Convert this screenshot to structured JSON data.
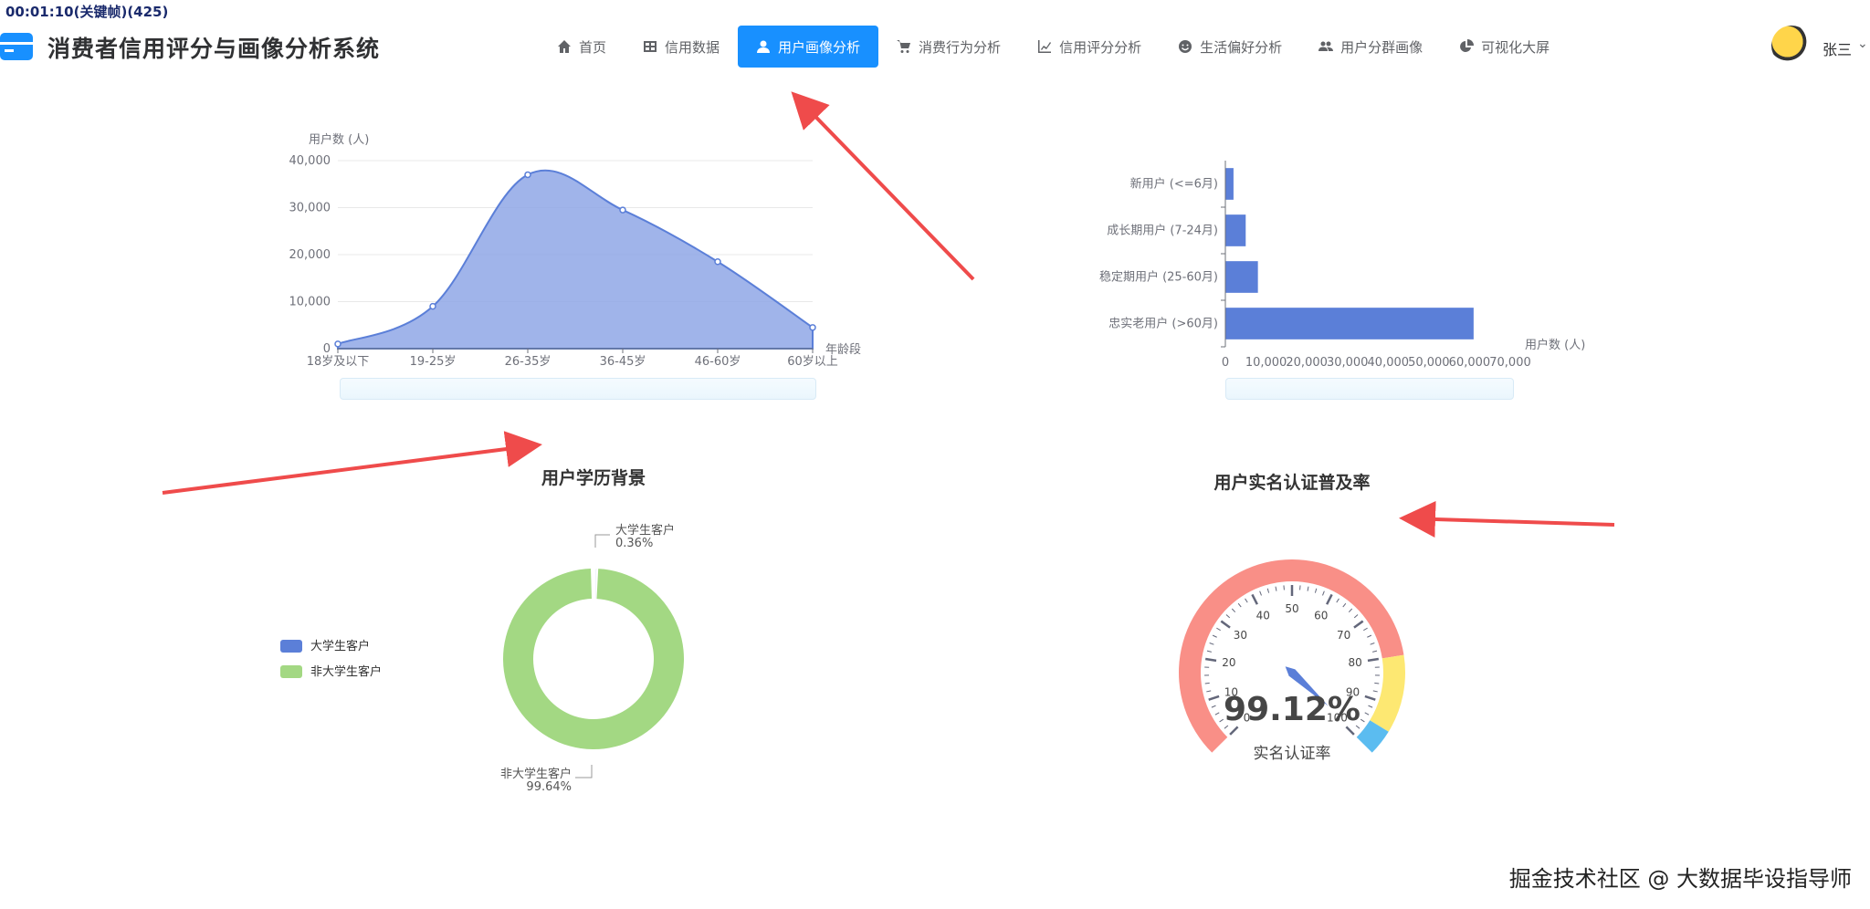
{
  "overlay": {
    "timer": "00:01:10(关键帧)(425)"
  },
  "header": {
    "title": "消费者信用评分与画像分析系统",
    "user_name": "张三",
    "caret": "⌄"
  },
  "nav": [
    {
      "label": "首页",
      "icon": "home-icon"
    },
    {
      "label": "信用数据",
      "icon": "table-icon"
    },
    {
      "label": "用户画像分析",
      "icon": "user-icon",
      "active": true
    },
    {
      "label": "消费行为分析",
      "icon": "cart-icon"
    },
    {
      "label": "信用评分分析",
      "icon": "line-chart-icon"
    },
    {
      "label": "生活偏好分析",
      "icon": "smile-icon"
    },
    {
      "label": "用户分群画像",
      "icon": "users-icon"
    },
    {
      "label": "可视化大屏",
      "icon": "pie-icon"
    }
  ],
  "colors": {
    "accent": "#1890ff",
    "blue": "#5b7fd8",
    "green": "#a3d883",
    "gauge_red": "#f98f87",
    "gauge_yellow": "#fde872",
    "gauge_blue": "#5bbcf0"
  },
  "watermark": "掘金技术社区 @ 大数据毕设指导师",
  "chart_data": [
    {
      "type": "area",
      "title": "",
      "ylabel": "用户数 (人)",
      "xlabel": "年龄段",
      "categories": [
        "18岁及以下",
        "19-25岁",
        "26-35岁",
        "36-45岁",
        "46-60岁",
        "60岁以上"
      ],
      "values": [
        1000,
        9000,
        37000,
        29500,
        18500,
        4500
      ],
      "ylim": [
        0,
        40000
      ],
      "yticks": [
        "0",
        "10,000",
        "20,000",
        "30,000",
        "40,000"
      ]
    },
    {
      "type": "bar",
      "orientation": "horizontal",
      "title": "",
      "xlabel": "用户数 (人)",
      "categories": [
        "忠实老用户 (>60月)",
        "稳定期用户 (25-60月)",
        "成长期用户 (7-24月)",
        "新用户 (<=6月)"
      ],
      "values": [
        61000,
        8000,
        5000,
        2000
      ],
      "xlim": [
        0,
        70000
      ],
      "xticks": [
        "0",
        "10,000",
        "20,000",
        "30,000",
        "40,000",
        "50,000",
        "60,000",
        "70,000"
      ]
    },
    {
      "type": "pie",
      "title": "用户学历背景",
      "legend": [
        "大学生客户",
        "非大学生客户"
      ],
      "slices": [
        {
          "name": "大学生客户",
          "pct_label": "0.36%",
          "value": 0.36
        },
        {
          "name": "非大学生客户",
          "pct_label": "99.64%",
          "value": 99.64
        }
      ]
    },
    {
      "type": "gauge",
      "title": "用户实名认证普及率",
      "value": 99.12,
      "value_label": "99.12%",
      "detail_label": "实名认证率",
      "ticks": [
        "0",
        "10",
        "20",
        "30",
        "40",
        "50",
        "60",
        "70",
        "80",
        "90",
        "100"
      ]
    }
  ]
}
